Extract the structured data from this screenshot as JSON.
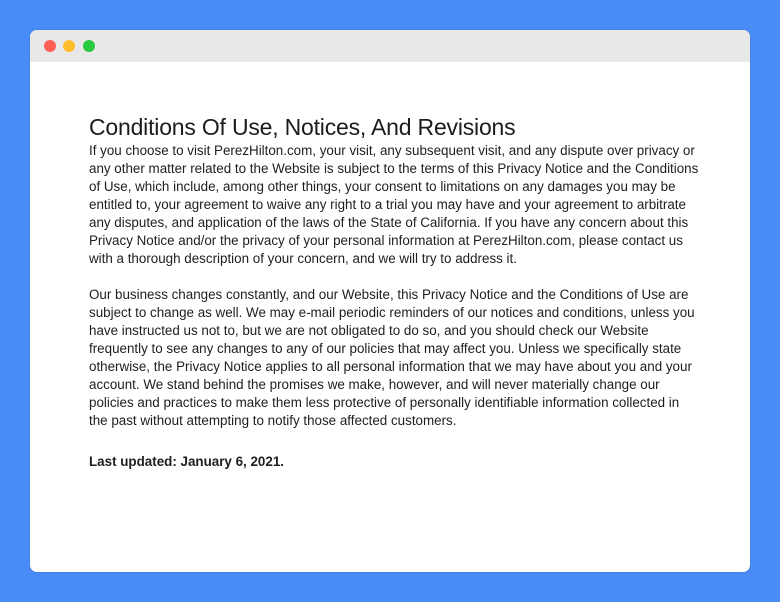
{
  "window": {
    "controls": [
      "close-icon",
      "minimize-icon",
      "maximize-icon"
    ],
    "colors": {
      "background": "#4a8cf7",
      "close": "#fe5f57",
      "minimize": "#febc2e",
      "maximize": "#28c840"
    }
  },
  "document": {
    "heading": "Conditions Of Use, Notices, And Revisions",
    "paragraph1": "If you choose to visit PerezHilton.com, your visit, any subsequent visit, and any dispute over privacy or any other matter related to the Website is subject to the terms of this Privacy Notice and the Conditions of Use, which include, among other things, your consent to limitations on any damages you may be entitled to, your agreement to waive any right to a trial you may have and your agreement to arbitrate any disputes, and application of the laws of the State of California. If you have any concern about this Privacy Notice and/or the privacy of your personal information at PerezHilton.com, please contact us with a thorough description of your concern, and we will try to address it.",
    "paragraph2": "Our business changes constantly, and our Website, this Privacy Notice and the Conditions of Use are subject to change as well. We may e-mail periodic reminders of our notices and conditions, unless you have instructed us not to, but we are not obligated to do so, and you should check our Website frequently to see any changes to any of our policies that may affect you. Unless we specifically state otherwise, the Privacy Notice applies to all personal information that we may have about you and your account. We stand behind the promises we make, however, and will never materially change our policies and practices to make them less protective of personally identifiable information collected in the past without attempting to notify those affected customers.",
    "last_updated": "Last updated: January 6, 2021."
  }
}
